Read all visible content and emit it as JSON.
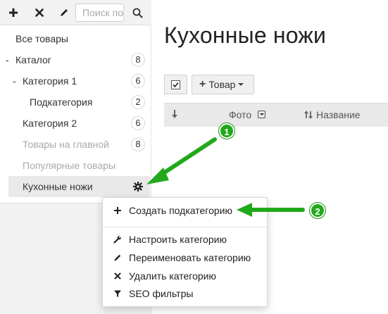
{
  "toolbar": {
    "add_icon": "plus-icon",
    "delete_icon": "close-icon",
    "edit_icon": "pencil-icon",
    "search_placeholder": "Поиск по",
    "search_icon": "search-icon"
  },
  "sidebar": {
    "items": [
      {
        "label": "Все товары",
        "count": null,
        "prefix": ""
      },
      {
        "label": "Каталог",
        "count": "8",
        "prefix": "-"
      },
      {
        "label": "Категория 1",
        "count": "6",
        "prefix": "-"
      },
      {
        "label": "Подкатегория",
        "count": "2",
        "prefix": ""
      },
      {
        "label": "Категория 2",
        "count": "6",
        "prefix": ""
      },
      {
        "label": "Товары на главной",
        "count": "8",
        "prefix": ""
      },
      {
        "label": "Популярные товары",
        "count": null,
        "prefix": ""
      },
      {
        "label": "Кухонные ножи",
        "count": null,
        "prefix": ""
      }
    ],
    "active_item": "Кухонные ножи"
  },
  "main": {
    "title": "Кухонные ножи",
    "product_button_label": "Товар",
    "columns": {
      "photo": "Фото",
      "name": "Название"
    }
  },
  "context_menu": {
    "items": [
      {
        "label": "Создать подкатегорию",
        "icon": "plus-icon"
      },
      {
        "label": "Настроить категорию",
        "icon": "wrench-icon"
      },
      {
        "label": "Переименовать категорию",
        "icon": "pencil-icon"
      },
      {
        "label": "Удалить категорию",
        "icon": "close-icon"
      },
      {
        "label": "SEO фильтры",
        "icon": "filter-icon"
      }
    ]
  },
  "annotations": {
    "step1": "1",
    "step2": "2",
    "color": "#22a81b"
  }
}
